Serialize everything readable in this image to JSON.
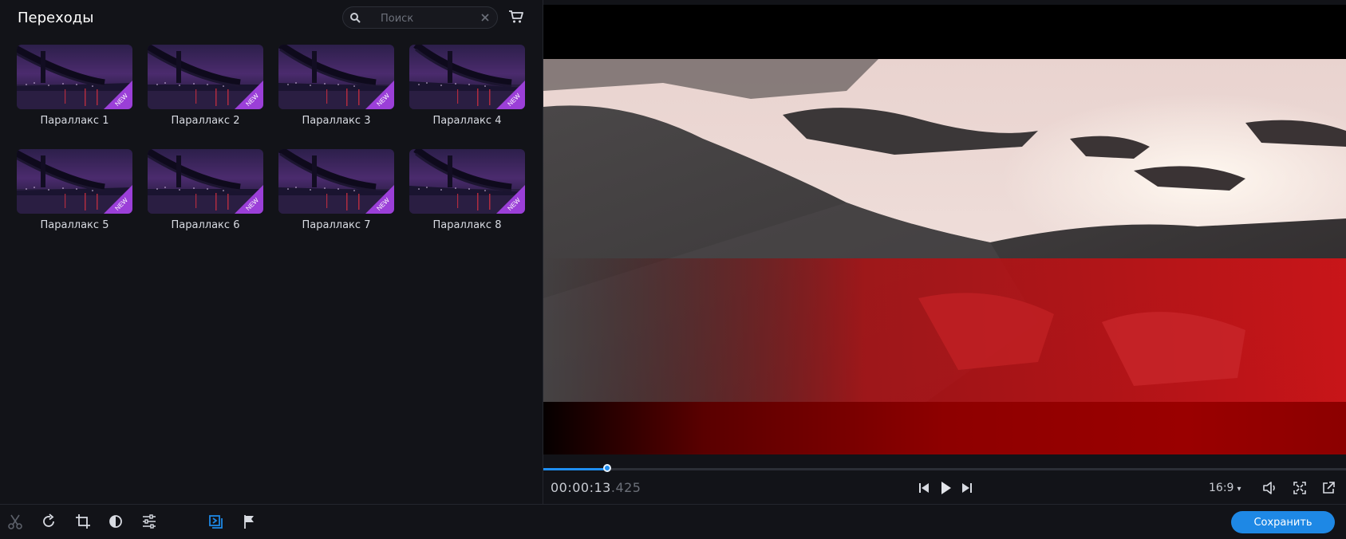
{
  "panel": {
    "title": "Переходы",
    "search": {
      "placeholder": "Поиск",
      "value": ""
    }
  },
  "transitions": [
    {
      "label": "Параллакс 1",
      "badge": "NEW"
    },
    {
      "label": "Параллакс 2",
      "badge": "NEW"
    },
    {
      "label": "Параллакс 3",
      "badge": "NEW"
    },
    {
      "label": "Параллакс 4",
      "badge": "NEW"
    },
    {
      "label": "Параллакс 5",
      "badge": "NEW"
    },
    {
      "label": "Параллакс 6",
      "badge": "NEW"
    },
    {
      "label": "Параллакс 7",
      "badge": "NEW"
    },
    {
      "label": "Параллакс 8",
      "badge": "NEW"
    }
  ],
  "player": {
    "timecode_main": "00:00:13",
    "timecode_ms": ".425",
    "aspect_ratio": "16:9",
    "progress": 0.08
  },
  "toolbar": {
    "save_label": "Сохранить"
  },
  "colors": {
    "accent": "#1e88e5",
    "badge": "#9b3fd8",
    "background": "#121318"
  },
  "icons": [
    "search-icon",
    "clear-icon",
    "cart-icon",
    "prev-icon",
    "play-icon",
    "next-icon",
    "volume-icon",
    "fit-icon",
    "external-icon",
    "cut-icon",
    "rotate-icon",
    "crop-icon",
    "color-icon",
    "adjust-icon",
    "transition-icon",
    "flag-icon"
  ]
}
